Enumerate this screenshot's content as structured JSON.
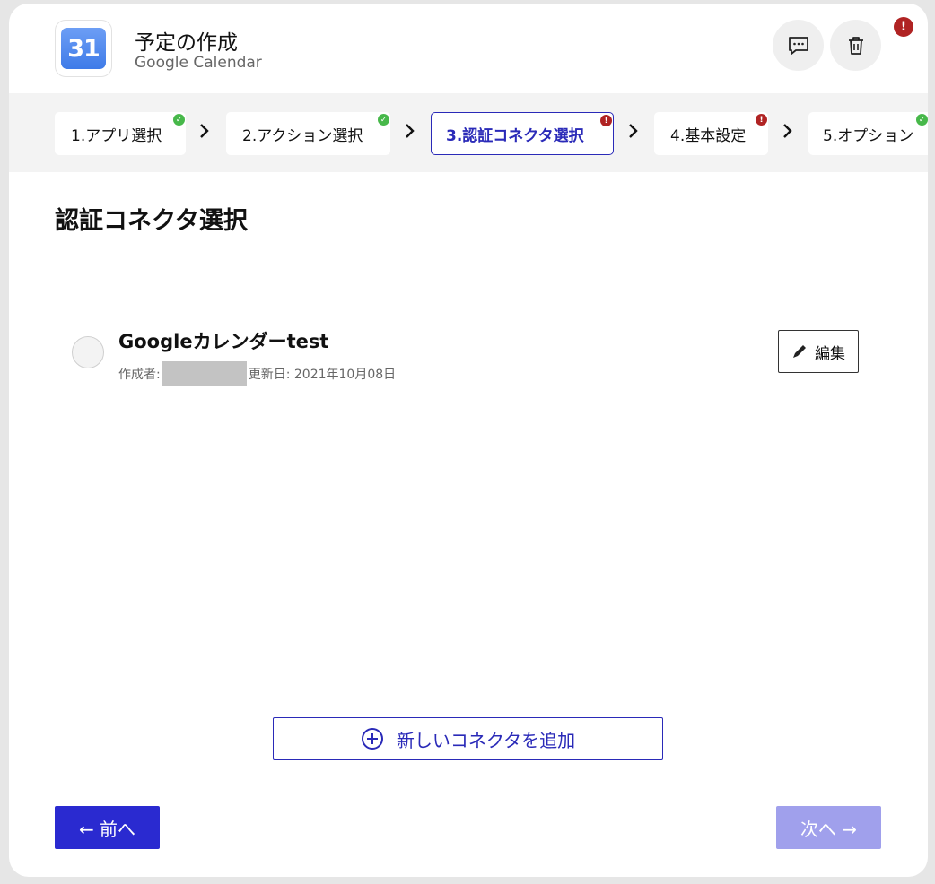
{
  "header": {
    "title": "予定の作成",
    "subtitle": "Google Calendar",
    "app_icon_text": "31",
    "alert_badge": "!"
  },
  "steps": [
    {
      "label": "1.アプリ選択",
      "status": "ok",
      "badge": "✓"
    },
    {
      "label": "2.アクション選択",
      "status": "ok",
      "badge": "✓"
    },
    {
      "label": "3.認証コネクタ選択",
      "status": "warn",
      "badge": "!"
    },
    {
      "label": "4.基本設定",
      "status": "warn",
      "badge": "!"
    },
    {
      "label": "5.オプション",
      "status": "ok",
      "badge": "✓"
    }
  ],
  "section": {
    "title": "認証コネクタ選択"
  },
  "connector": {
    "name": "Googleカレンダーtest",
    "author_label": "作成者:",
    "updated_label": "更新日: 2021年10月08日",
    "edit_label": "編集"
  },
  "add_button": {
    "label": "新しいコネクタを追加"
  },
  "footer": {
    "prev_label": "← 前へ",
    "next_label": "次へ →"
  },
  "colors": {
    "accent": "#2a2ad0",
    "accent_disabled": "#a0a0ec",
    "ok": "#47b84a",
    "warn": "#b02323"
  }
}
